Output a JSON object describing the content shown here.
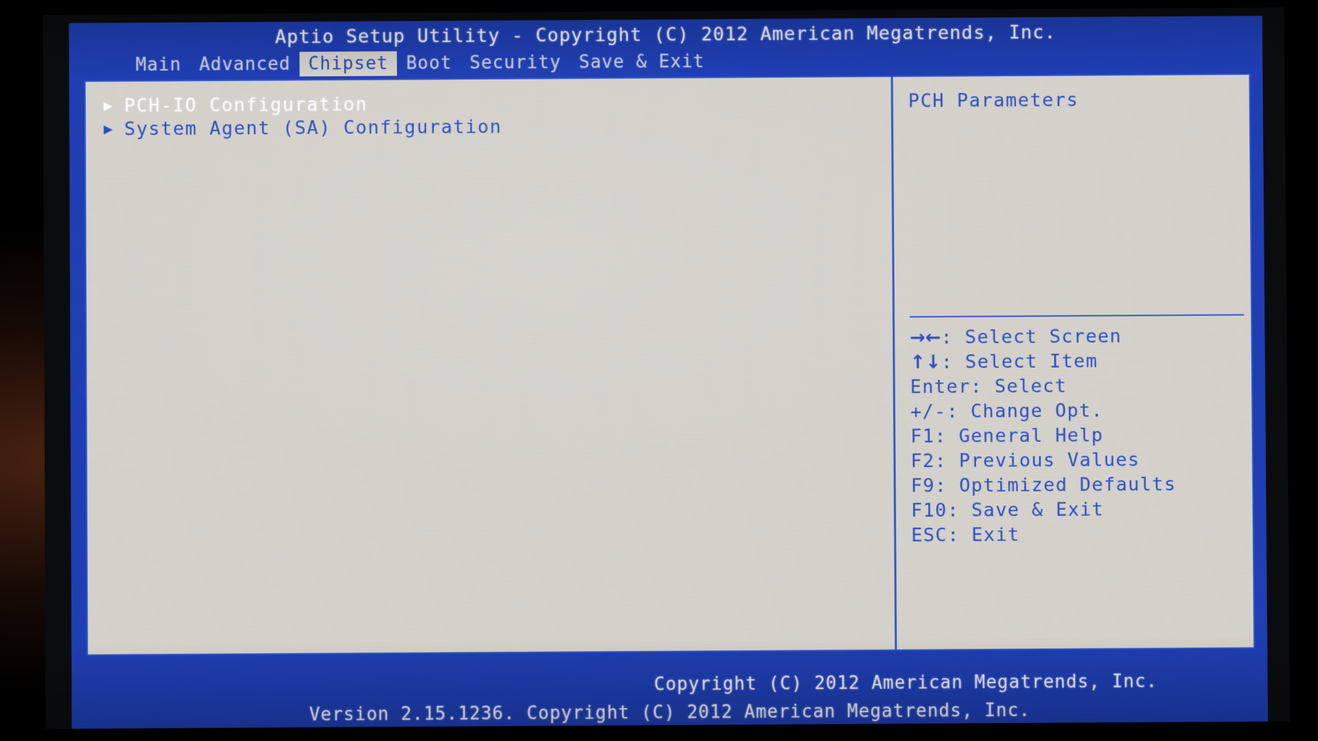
{
  "titlebar": {
    "text": "Aptio Setup Utility - Copyright (C) 2012 American Megatrends, Inc."
  },
  "menubar": {
    "items": [
      {
        "label": "Main",
        "active": false
      },
      {
        "label": "Advanced",
        "active": false
      },
      {
        "label": "Chipset",
        "active": true
      },
      {
        "label": "Boot",
        "active": false
      },
      {
        "label": "Security",
        "active": false
      },
      {
        "label": "Save & Exit",
        "active": false
      }
    ]
  },
  "left_pane": {
    "items": [
      {
        "arrow": "▶",
        "label": "PCH-IO Configuration",
        "selected": true
      },
      {
        "arrow": "▶",
        "label": "System Agent (SA) Configuration",
        "selected": false
      }
    ]
  },
  "right_pane": {
    "help_title": "PCH Parameters",
    "keys": [
      {
        "glyph": "→←",
        "text": ": Select Screen"
      },
      {
        "glyph": "↑↓",
        "text": ": Select Item"
      },
      {
        "glyph": "",
        "text": "Enter: Select"
      },
      {
        "glyph": "",
        "text": "+/-: Change Opt."
      },
      {
        "glyph": "",
        "text": "F1: General Help"
      },
      {
        "glyph": "",
        "text": "F2: Previous Values"
      },
      {
        "glyph": "",
        "text": "F9: Optimized Defaults"
      },
      {
        "glyph": "",
        "text": "F10: Save & Exit"
      },
      {
        "glyph": "",
        "text": "ESC: Exit"
      }
    ]
  },
  "footer": {
    "upper": "Copyright (C) 2012 American Megatrends, Inc.",
    "version": "Version 2.15.1236. Copyright (C) 2012 American Megatrends, Inc."
  },
  "colors": {
    "bios_blue": "#1f3fb5",
    "panel_gray": "#d6d4cd",
    "text_blue": "#2e4fc4",
    "border_blue": "#3257c9",
    "highlight_text": "#ffffff"
  }
}
